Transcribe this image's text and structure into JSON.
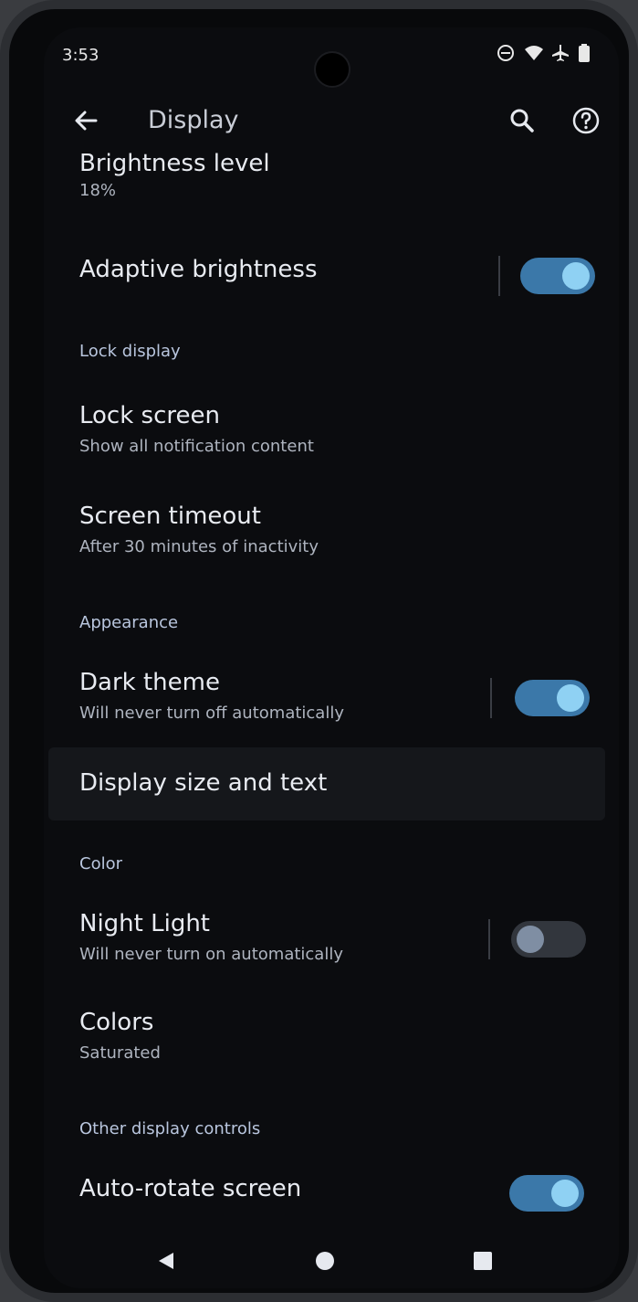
{
  "status_bar": {
    "time": "3:53",
    "icons": [
      "do-not-disturb-icon",
      "wifi-icon",
      "airplane-icon",
      "battery-icon"
    ]
  },
  "app_bar": {
    "title": "Display",
    "back_icon": "back-arrow-icon",
    "search_icon": "search-icon",
    "help_icon": "help-icon"
  },
  "brightness": {
    "title": "Brightness level",
    "value": "18%"
  },
  "adaptive_brightness": {
    "title": "Adaptive brightness",
    "enabled": true
  },
  "sections": {
    "lock_display": "Lock display",
    "appearance": "Appearance",
    "color": "Color",
    "other_controls": "Other display controls"
  },
  "lock_screen": {
    "title": "Lock screen",
    "summary": "Show all notification content"
  },
  "screen_timeout": {
    "title": "Screen timeout",
    "summary": "After 30 minutes of inactivity"
  },
  "dark_theme": {
    "title": "Dark theme",
    "summary": "Will never turn off automatically",
    "enabled": true
  },
  "display_size": {
    "title": "Display size and text"
  },
  "night_light": {
    "title": "Night Light",
    "summary": "Will never turn on automatically",
    "enabled": false
  },
  "colors": {
    "title": "Colors",
    "summary": "Saturated"
  },
  "auto_rotate": {
    "title": "Auto-rotate screen",
    "enabled": true
  },
  "nav_bar": {
    "back_icon": "nav-back-icon",
    "home_icon": "nav-home-icon",
    "recents_icon": "nav-recents-icon"
  },
  "colors_theme": {
    "accent": "#3b78a9",
    "switch_thumb_on": "#8fd1f3",
    "background": "#0b0c0f"
  }
}
